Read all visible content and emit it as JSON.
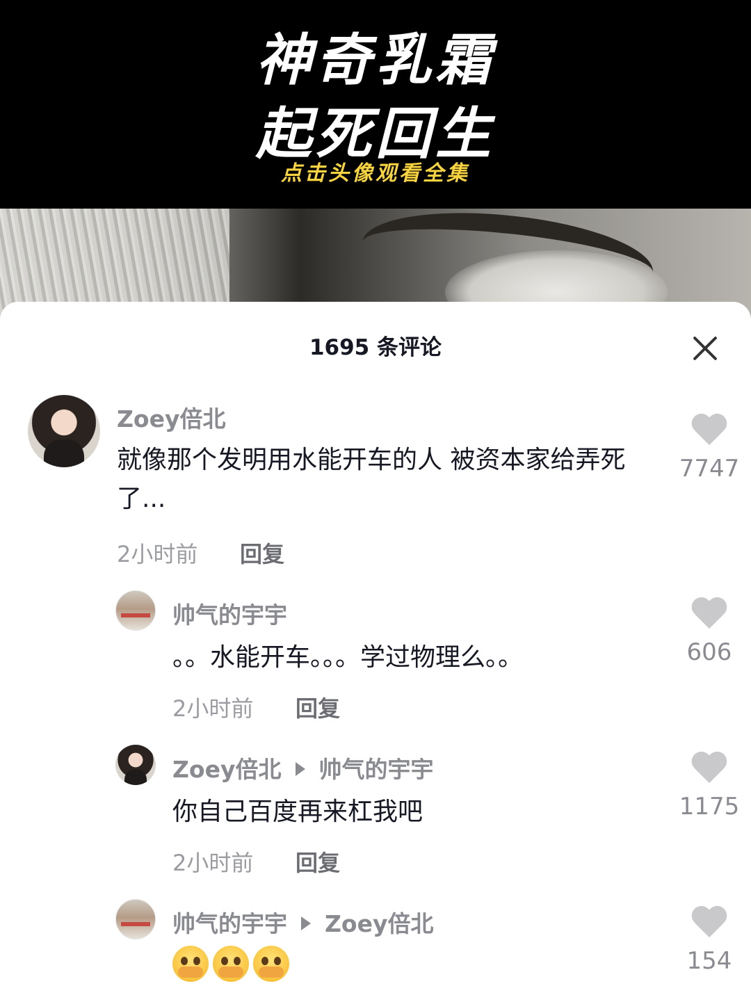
{
  "banner": {
    "line1": "神奇乳霜",
    "line2": "起死回生",
    "subtitle": "点击头像观看全集"
  },
  "comments_panel": {
    "title": "1695 条评论",
    "close_icon": "close-icon"
  },
  "comments": [
    {
      "username": "Zoey倍北",
      "text": "就像那个发明用水能开车的人 被资本家给弄死了...",
      "time": "2小时前",
      "reply_label": "回复",
      "likes": "7747"
    },
    {
      "username": "帅气的宇宇",
      "text": "。。水能开车。。。学过物理么。。",
      "time": "2小时前",
      "reply_label": "回复",
      "likes": "606"
    },
    {
      "username": "Zoey倍北",
      "reply_to": "帅气的宇宇",
      "text": "你自己百度再来杠我吧",
      "time": "2小时前",
      "reply_label": "回复",
      "likes": "1175"
    },
    {
      "username": "帅气的宇宇",
      "reply_to": "Zoey倍北",
      "emojis": [
        "pleading-emoji",
        "pleading-emoji",
        "pleading-emoji"
      ],
      "likes": "154"
    }
  ]
}
